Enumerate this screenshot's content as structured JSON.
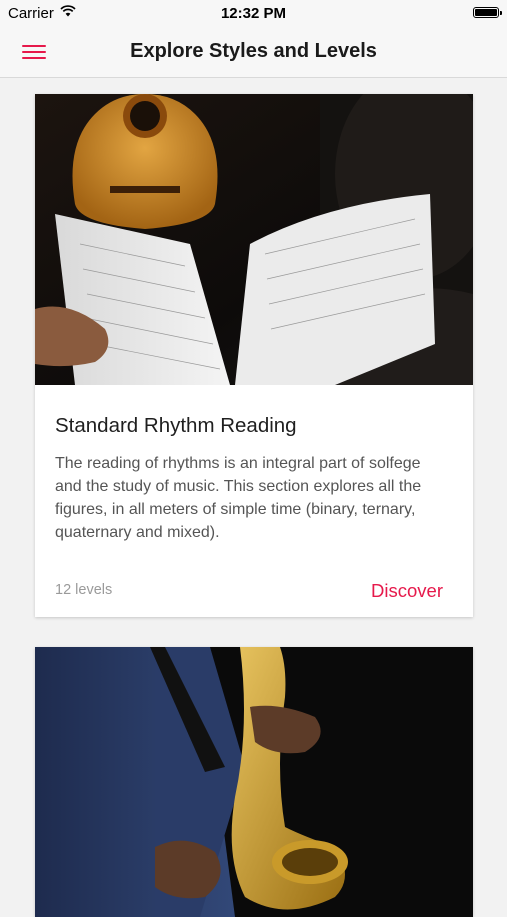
{
  "status_bar": {
    "carrier": "Carrier",
    "time": "12:32 PM"
  },
  "nav": {
    "title": "Explore Styles and Levels",
    "menu_icon": "hamburger-menu-icon"
  },
  "cards": [
    {
      "image_subject": "sheet music book with guitar",
      "title": "Standard Rhythm Reading",
      "description": "The reading of rhythms is an integral part of solfege and the study of music. This section explores all the figures, in all meters of simple time (binary, ternary, quaternary and mixed).",
      "levels": "12 levels",
      "action": "Discover"
    },
    {
      "image_subject": "saxophone player"
    }
  ],
  "colors": {
    "accent": "#e6194b",
    "background": "#f2f2f2",
    "bar": "#f7f7f7"
  }
}
